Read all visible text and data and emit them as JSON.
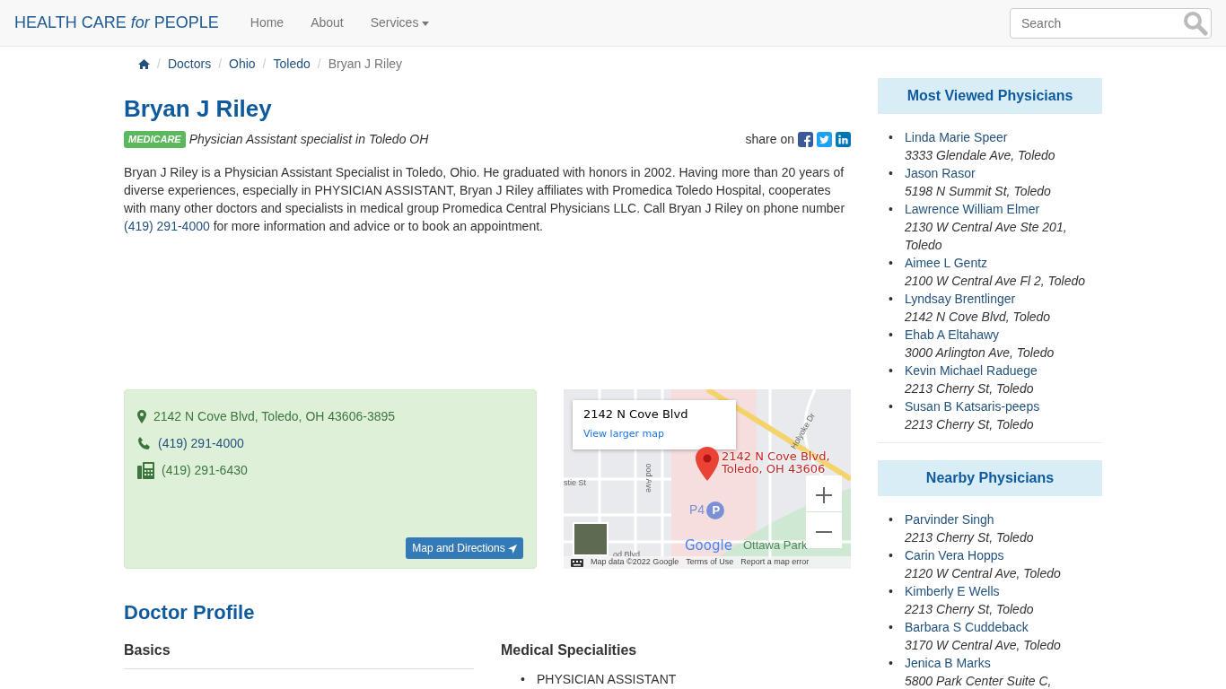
{
  "navbar": {
    "brand": "HEALTH CARE *for* PEOPLE",
    "links": [
      {
        "label": "Home",
        "dropdown": false
      },
      {
        "label": "About",
        "dropdown": false
      },
      {
        "label": "Services",
        "dropdown": true
      }
    ],
    "search": {
      "placeholder": "Search"
    }
  },
  "breadcrumb": {
    "separator": "/",
    "items": [
      "Doctors",
      "Ohio",
      "Toledo",
      "Bryan J Riley"
    ]
  },
  "doctor": {
    "name": "Bryan J Riley",
    "badge": "MEDICARE",
    "subtitle": "Physician Assistant specialist in Toledo OH",
    "share_label": "share on",
    "bio": "Bryan J Riley is a Physician Assistant Specialist in Toledo, Ohio. He graduated with honors in 2002. Having more than 20 years of diverse experiences, especially in PHYSICIAN ASSISTANT, Bryan J Riley affiliates with Promedica Toledo Hospital, cooperates with many other doctors and specialists in medical group Promedica Central Physicians LLC. Call Bryan J Riley on phone number",
    "bio_phone": "(419) 291-4000",
    "bio_end": "for more information and advice or to book an appointment."
  },
  "contact": {
    "address": "2142 N Cove Blvd, Toledo, OH 43606-3895",
    "phone": "(419) 291-4000",
    "fax": "(419) 291-6430",
    "button": "Map and Directions"
  },
  "map": {
    "info_title": "2142 N Cove Blvd",
    "info_link": "View larger map",
    "marker_label": [
      "2142 N Cove Blvd,",
      "Toledo, OH 43606"
    ],
    "streets": [
      "Holyoke Dr",
      "ood Ave",
      "stie St",
      "od Blvd",
      "Ottawa Park"
    ],
    "parking": "P4",
    "parking_icon": "P",
    "logo": "Google",
    "footer": [
      "Map data ©2022 Google",
      "Terms of Use",
      "Report a map error"
    ]
  },
  "profile": {
    "title": "Doctor Profile",
    "basics": "Basics",
    "specialities_title": "Medical Specialities",
    "bullet": "•",
    "specialities": [
      "PHYSICIAN ASSISTANT"
    ]
  },
  "sidebar": [
    {
      "title": "Most Viewed Physicians",
      "bullet": "•",
      "items": [
        {
          "name": "Linda Marie Speer",
          "address": "3333 Glendale Ave, Toledo"
        },
        {
          "name": "Jason Rasor",
          "address": "5198 N Summit St, Toledo"
        },
        {
          "name": "Lawrence William Elmer",
          "address": "2130 W Central Ave Ste 201, Toledo"
        },
        {
          "name": "Aimee L Gentz",
          "address": "2100 W Central Ave Fl 2, Toledo"
        },
        {
          "name": "Lyndsay Brentlinger",
          "address": "2142 N Cove Blvd, Toledo"
        },
        {
          "name": "Ehab A Eltahawy",
          "address": "3000 Arlington Ave, Toledo"
        },
        {
          "name": "Kevin Michael Raduege",
          "address": "2213 Cherry St, Toledo"
        },
        {
          "name": "Susan B Katsaris-peeps",
          "address": "2213 Cherry St, Toledo"
        }
      ]
    },
    {
      "title": "Nearby Physicians",
      "bullet": "•",
      "items": [
        {
          "name": "Parvinder Singh",
          "address": "2213 Cherry St, Toledo"
        },
        {
          "name": "Carin Vera Hopps",
          "address": "2120 W Central Ave, Toledo"
        },
        {
          "name": "Kimberly E Wells",
          "address": "2213 Cherry St, Toledo"
        },
        {
          "name": "Barbara S Cuddeback",
          "address": "3170 W Central Ave, Toledo"
        },
        {
          "name": "Jenica B Marks",
          "address": "5800 Park Center Suite C,"
        }
      ]
    }
  ]
}
